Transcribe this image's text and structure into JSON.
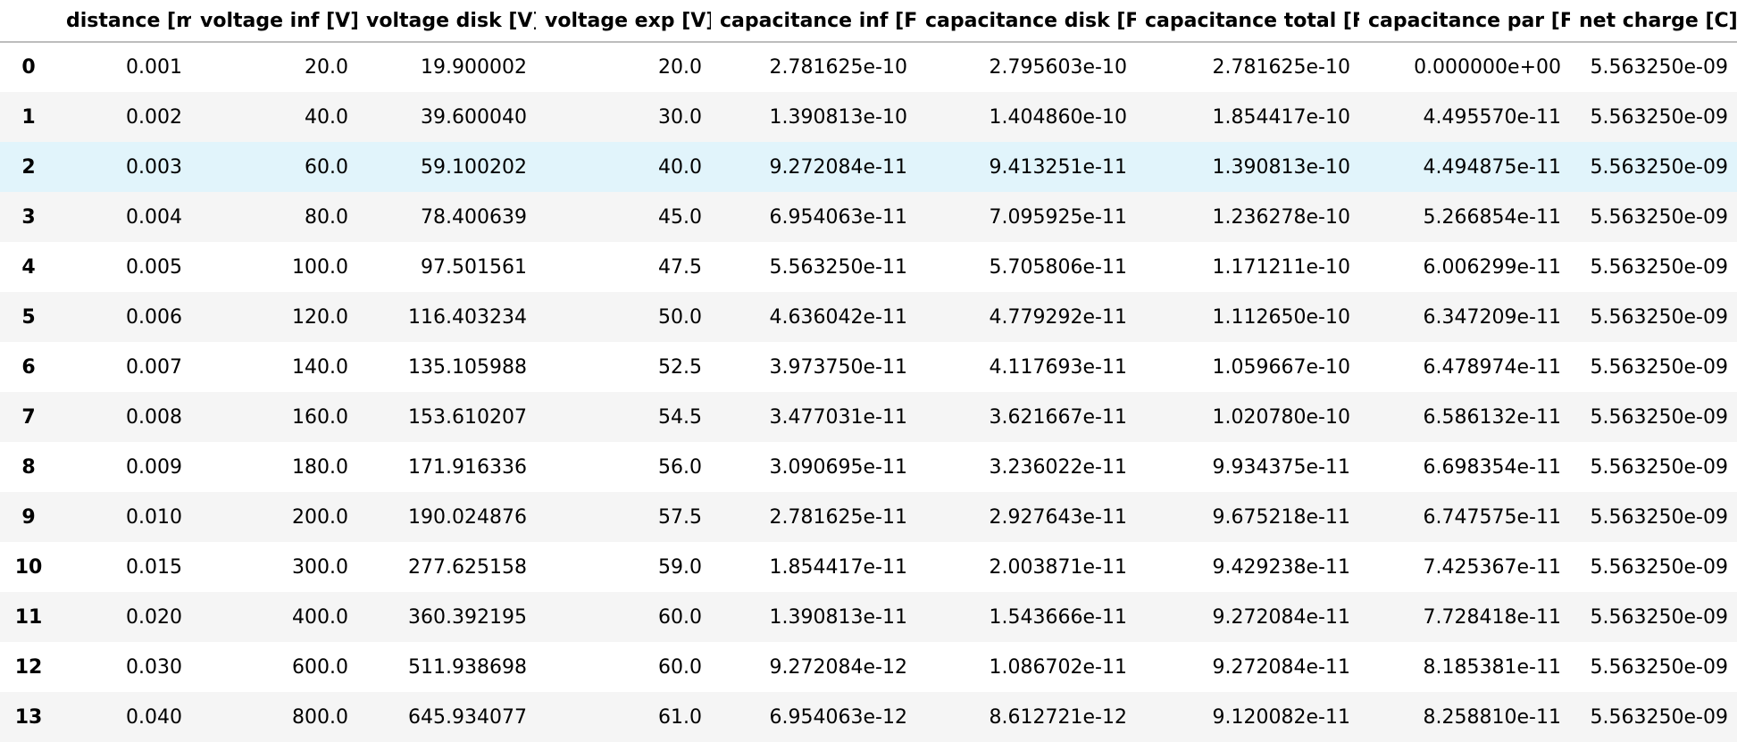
{
  "table": {
    "index_header": "",
    "columns": [
      "distance [m]",
      "voltage inf [V]",
      "voltage disk [V]",
      "voltage exp [V]",
      "capacitance inf [F]",
      "capacitance disk [F]",
      "capacitance total [F]",
      "capacitance par [F]",
      "net charge [C]"
    ],
    "rows": [
      {
        "index": "0",
        "cells": [
          "0.001",
          "20.0",
          "19.900002",
          "20.0",
          "2.781625e-10",
          "2.795603e-10",
          "2.781625e-10",
          "0.000000e+00",
          "5.563250e-09"
        ]
      },
      {
        "index": "1",
        "cells": [
          "0.002",
          "40.0",
          "39.600040",
          "30.0",
          "1.390813e-10",
          "1.404860e-10",
          "1.854417e-10",
          "4.495570e-11",
          "5.563250e-09"
        ]
      },
      {
        "index": "2",
        "cells": [
          "0.003",
          "60.0",
          "59.100202",
          "40.0",
          "9.272084e-11",
          "9.413251e-11",
          "1.390813e-10",
          "4.494875e-11",
          "5.563250e-09"
        ]
      },
      {
        "index": "3",
        "cells": [
          "0.004",
          "80.0",
          "78.400639",
          "45.0",
          "6.954063e-11",
          "7.095925e-11",
          "1.236278e-10",
          "5.266854e-11",
          "5.563250e-09"
        ]
      },
      {
        "index": "4",
        "cells": [
          "0.005",
          "100.0",
          "97.501561",
          "47.5",
          "5.563250e-11",
          "5.705806e-11",
          "1.171211e-10",
          "6.006299e-11",
          "5.563250e-09"
        ]
      },
      {
        "index": "5",
        "cells": [
          "0.006",
          "120.0",
          "116.403234",
          "50.0",
          "4.636042e-11",
          "4.779292e-11",
          "1.112650e-10",
          "6.347209e-11",
          "5.563250e-09"
        ]
      },
      {
        "index": "6",
        "cells": [
          "0.007",
          "140.0",
          "135.105988",
          "52.5",
          "3.973750e-11",
          "4.117693e-11",
          "1.059667e-10",
          "6.478974e-11",
          "5.563250e-09"
        ]
      },
      {
        "index": "7",
        "cells": [
          "0.008",
          "160.0",
          "153.610207",
          "54.5",
          "3.477031e-11",
          "3.621667e-11",
          "1.020780e-10",
          "6.586132e-11",
          "5.563250e-09"
        ]
      },
      {
        "index": "8",
        "cells": [
          "0.009",
          "180.0",
          "171.916336",
          "56.0",
          "3.090695e-11",
          "3.236022e-11",
          "9.934375e-11",
          "6.698354e-11",
          "5.563250e-09"
        ]
      },
      {
        "index": "9",
        "cells": [
          "0.010",
          "200.0",
          "190.024876",
          "57.5",
          "2.781625e-11",
          "2.927643e-11",
          "9.675218e-11",
          "6.747575e-11",
          "5.563250e-09"
        ]
      },
      {
        "index": "10",
        "cells": [
          "0.015",
          "300.0",
          "277.625158",
          "59.0",
          "1.854417e-11",
          "2.003871e-11",
          "9.429238e-11",
          "7.425367e-11",
          "5.563250e-09"
        ]
      },
      {
        "index": "11",
        "cells": [
          "0.020",
          "400.0",
          "360.392195",
          "60.0",
          "1.390813e-11",
          "1.543666e-11",
          "9.272084e-11",
          "7.728418e-11",
          "5.563250e-09"
        ]
      },
      {
        "index": "12",
        "cells": [
          "0.030",
          "600.0",
          "511.938698",
          "60.0",
          "9.272084e-12",
          "1.086702e-11",
          "9.272084e-11",
          "8.185381e-11",
          "5.563250e-09"
        ]
      },
      {
        "index": "13",
        "cells": [
          "0.040",
          "800.0",
          "645.934077",
          "61.0",
          "6.954063e-12",
          "8.612721e-12",
          "9.120082e-11",
          "8.258810e-11",
          "5.563250e-09"
        ]
      }
    ],
    "highlighted_row_index": "2",
    "colors": {
      "highlight": "#e1f4fb",
      "stripe": "#f5f5f5",
      "header_rule": "#bdbdbd"
    }
  }
}
